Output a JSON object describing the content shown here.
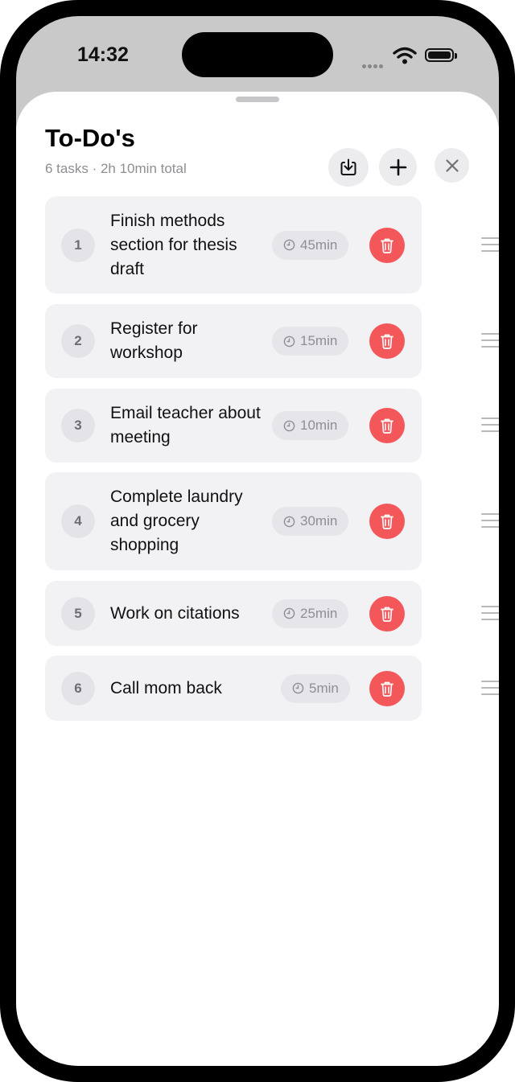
{
  "status_bar": {
    "time": "14:32"
  },
  "header": {
    "title": "To-Do's",
    "subtitle": "6 tasks · 2h 10min total"
  },
  "tasks": [
    {
      "number": "1",
      "text": "Finish methods section for thesis draft",
      "duration": "45min"
    },
    {
      "number": "2",
      "text": "Register for workshop",
      "duration": "15min"
    },
    {
      "number": "3",
      "text": "Email teacher about meeting",
      "duration": "10min"
    },
    {
      "number": "4",
      "text": "Complete laundry and grocery shopping",
      "duration": "30min"
    },
    {
      "number": "5",
      "text": "Work on citations",
      "duration": "25min"
    },
    {
      "number": "6",
      "text": "Call mom back",
      "duration": "5min"
    }
  ],
  "icons": {
    "export": "download-tray-icon",
    "add": "plus-icon",
    "close": "close-icon",
    "duration": "clock-icon",
    "delete": "trash-icon",
    "reorder": "drag-handle-icon"
  },
  "colors": {
    "delete": "#f4575a",
    "row_bg": "#f2f2f5"
  }
}
